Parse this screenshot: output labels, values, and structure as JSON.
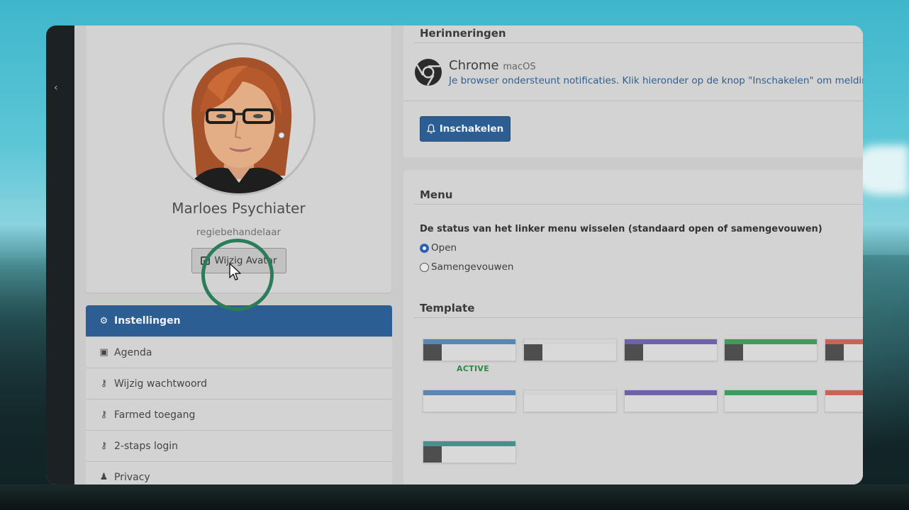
{
  "window": {
    "collapse_label": "‹"
  },
  "profile": {
    "name": "Marloes Psychiater",
    "role": "regiebehandelaar",
    "change_avatar_label": "Wijzig Avatar"
  },
  "settings_menu": [
    {
      "label": "Instellingen",
      "icon": "gears-icon",
      "glyph": "⚙",
      "active": true
    },
    {
      "label": "Agenda",
      "icon": "calendar-check-icon",
      "glyph": "▣",
      "active": false
    },
    {
      "label": "Wijzig wachtwoord",
      "icon": "key-icon",
      "glyph": "⚷",
      "active": false
    },
    {
      "label": "Farmed toegang",
      "icon": "key-icon",
      "glyph": "⚷",
      "active": false
    },
    {
      "label": "2-staps login",
      "icon": "key-icon",
      "glyph": "⚷",
      "active": false
    },
    {
      "label": "Privacy",
      "icon": "user-secret-icon",
      "glyph": "♟",
      "active": false
    }
  ],
  "reminders": {
    "title": "Herinneringen",
    "browser_name": "Chrome",
    "browser_os": "macOS",
    "message": "Je browser ondersteunt notificaties. Klik hieronder op de knop \"Inschakelen\" om meldingen t",
    "enable_label": "Inschakelen"
  },
  "menu_section": {
    "title": "Menu",
    "description": "De status van het linker menu wisselen (standaard open of samengevouwen)",
    "options": [
      {
        "label": "Open",
        "checked": true
      },
      {
        "label": "Samengevouwen",
        "checked": false
      }
    ]
  },
  "template_section": {
    "title": "Template",
    "active_label": "ACTIVE",
    "colors": {
      "blue": "#5a86b4",
      "gray": "#cfcfcf",
      "purple": "#6c63a8",
      "green": "#3f9a5c",
      "red": "#c96458",
      "teal": "#4a8f8d",
      "sidebar_dark": "#4e4e4e"
    }
  },
  "accent_color": "#2c5d93"
}
